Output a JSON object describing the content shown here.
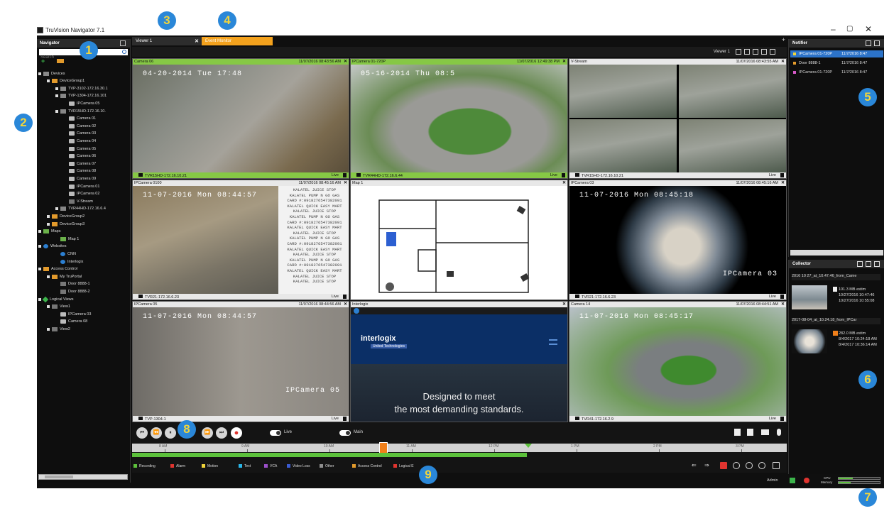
{
  "app": {
    "title": "TruVision Navigator 7.1"
  },
  "window": {
    "minimize": "–",
    "maximize": "▢",
    "close": "✕"
  },
  "navigator": {
    "title": "Navigator",
    "search_placeholder": "Search",
    "tree": [
      {
        "label": "Devices",
        "icon": "server",
        "level": 0
      },
      {
        "label": "DeviceGroup1",
        "icon": "folder",
        "level": 1
      },
      {
        "label": "TVP-3102-172.16.30.1",
        "icon": "server",
        "level": 2
      },
      {
        "label": "TVP-1304-172.16.101",
        "icon": "server",
        "level": 2
      },
      {
        "label": "IPCamera 05",
        "icon": "cam",
        "level": 3
      },
      {
        "label": "TVR15HD-172.16.10.",
        "icon": "server",
        "level": 2
      },
      {
        "label": "Camera 01",
        "icon": "cam",
        "level": 3
      },
      {
        "label": "Camera 02",
        "icon": "cam",
        "level": 3
      },
      {
        "label": "Camera 03",
        "icon": "cam",
        "level": 3
      },
      {
        "label": "Camera 04",
        "icon": "cam",
        "level": 3
      },
      {
        "label": "Camera 05",
        "icon": "cam",
        "level": 3
      },
      {
        "label": "Camera 06",
        "icon": "cam",
        "level": 3
      },
      {
        "label": "Camera 07",
        "icon": "cam",
        "level": 3
      },
      {
        "label": "Camera 08",
        "icon": "cam",
        "level": 3
      },
      {
        "label": "Camera 09",
        "icon": "cam",
        "level": 3
      },
      {
        "label": "IPCamera 01",
        "icon": "cam",
        "level": 3
      },
      {
        "label": "IPCamera 02",
        "icon": "cam",
        "level": 3
      },
      {
        "label": "V-Stream",
        "icon": "view",
        "level": 3
      },
      {
        "label": "TVR44HD-172.16.6.4",
        "icon": "server",
        "level": 2
      },
      {
        "label": "DeviceGroup2",
        "icon": "folder",
        "level": 1
      },
      {
        "label": "DeviceGroup3",
        "icon": "folder",
        "level": 1
      },
      {
        "label": "Maps",
        "icon": "map",
        "level": 0
      },
      {
        "label": "Map 1",
        "icon": "map",
        "level": 2
      },
      {
        "label": "Websites",
        "icon": "web",
        "level": 0
      },
      {
        "label": "CNN",
        "icon": "web",
        "level": 2
      },
      {
        "label": "Interlogix",
        "icon": "web",
        "level": 2
      },
      {
        "label": "Access Control",
        "icon": "ac",
        "level": 0
      },
      {
        "label": "My TruPortal",
        "icon": "ac",
        "level": 1
      },
      {
        "label": "Door 8888-1",
        "icon": "view",
        "level": 2
      },
      {
        "label": "Door 8888-2",
        "icon": "view",
        "level": 2
      },
      {
        "label": "Logical Views",
        "icon": "lv",
        "level": 0
      },
      {
        "label": "View1",
        "icon": "view",
        "level": 1
      },
      {
        "label": "IPCamera 03",
        "icon": "cam",
        "level": 2
      },
      {
        "label": "Camera 08",
        "icon": "cam",
        "level": 2
      },
      {
        "label": "View2",
        "icon": "view",
        "level": 1
      }
    ]
  },
  "tabs": [
    {
      "label": "Viewer 1",
      "close": "✕"
    },
    {
      "label": "Event Monitor",
      "close": "✕"
    }
  ],
  "tab_add": "+",
  "viewer_label": "Viewer 1",
  "cells": [
    {
      "name": "Camera 06",
      "time": "11/07/2016 08:43:56 AM",
      "footer": "TVR15HD-172.16.10.21",
      "live": "Live",
      "osd": "04-20-2014 Tue 17:48",
      "selected": true
    },
    {
      "name": "IPCamera 01-720P",
      "time": "11/07/2016 12:49:38 PM",
      "footer": "TVR44HD-172.16.6.44",
      "live": "Live",
      "osd": "05-16-2014 Thu 08:5",
      "selected": true
    },
    {
      "name": "V-Stream",
      "time": "11/07/2016 08:43:55 AM",
      "footer": "TVR15HD-172.16.10.21",
      "live": "Live",
      "osd": ""
    },
    {
      "name": "IPCamera 0100",
      "time": "11/07/2016 08:45:16 AM",
      "footer": "TVR21-172.16.6.23",
      "live": "Live",
      "osd": "11-07-2016 Mon 08:44:57"
    },
    {
      "name": "Map 1",
      "time": "",
      "footer": "",
      "live": "",
      "osd": ""
    },
    {
      "name": "IPCamera 03",
      "time": "11/07/2016 08:45:16 AM",
      "footer": "TVR21-172.16.6.23",
      "live": "Live",
      "osd": "11-07-2016 Mon 08:45:18"
    },
    {
      "name": "IPCamera 05",
      "time": "11/07/2016 08:44:56 AM",
      "footer": "TVP-1304-1",
      "live": "Live",
      "osd": "11-07-2016 Mon 08:44:57"
    },
    {
      "name": "Interlogix",
      "time": "",
      "footer": "",
      "live": "",
      "osd": ""
    },
    {
      "name": "Camera 14",
      "time": "11/07/2016 08:44:51 AM",
      "footer": "TVR41-172.16.2.9",
      "live": "Live",
      "osd": "11-07-2016 Mon 08:45:17"
    }
  ],
  "osd_camera_labels": {
    "cell6": "IPCamera 03",
    "cell7": "IPCamera 05"
  },
  "pos_lines": [
    "KALATEL JUICE STOP",
    "KALATEL PUMP N GO GAS",
    "CARD #:0918276547382091",
    "KALATEL QUICK EASY MART",
    "KALATEL JUICE STOP",
    "KALATEL PUMP N GO GAS",
    "CARD #:0918276547382091",
    "KALATEL QUICK EASY MART",
    "KALATEL JUICE STOP",
    "KALATEL PUMP N GO GAS",
    "CARD #:0918276547382091",
    "KALATEL QUICK EASY MART",
    "KALATEL JUICE STOP",
    "KALATEL PUMP N GO GAS",
    "CARD #:0918276547382091",
    "KALATEL QUICK EASY MART",
    "KALATEL JUICE STOP",
    "KALATEL JUICE STOP"
  ],
  "web": {
    "brand": "interlogix",
    "sub": "United Technologies",
    "tagline1": "Designed to meet",
    "tagline2": "the most demanding standards."
  },
  "playback": {
    "buttons": [
      "⏮",
      "⏪",
      "⏸",
      "⏩",
      "⏭",
      "●"
    ],
    "live_toggle": "Live",
    "main_toggle": "Main",
    "ticks": [
      "8 AM",
      "9 AM",
      "10 AM",
      "11 AM",
      "12 PM",
      "1 PM",
      "2 PM",
      "3 PM"
    ],
    "legend": [
      {
        "label": "Recording",
        "color": "#5cc13b"
      },
      {
        "label": "Alarm",
        "color": "#e0342f"
      },
      {
        "label": "Motion",
        "color": "#f0d43a"
      },
      {
        "label": "Text",
        "color": "#29b6e8"
      },
      {
        "label": "VCA",
        "color": "#9b4fc9"
      },
      {
        "label": "Video Loss",
        "color": "#3b5bd1"
      },
      {
        "label": "Other",
        "color": "#8e8e8e"
      },
      {
        "label": "Access Control",
        "color": "#e29a2c"
      },
      {
        "label": "Logical E",
        "color": "#e0342f"
      }
    ]
  },
  "notifier": {
    "title": "Notifier",
    "rows": [
      {
        "source": "IPCamera 01-720P",
        "time": "11/7/2016 8:47",
        "color": "#f0d43a",
        "selected": true
      },
      {
        "source": "Door 8888-1",
        "time": "11/7/2016 8:47",
        "color": "#e29a2c",
        "selected": false
      },
      {
        "source": "IPCamera 01-720P",
        "time": "11/7/2016 8:47",
        "color": "#d659c8",
        "selected": false
      }
    ]
  },
  "collector": {
    "title": "Collector",
    "items": [
      {
        "title": "2016 10 27_at_10.47.46_from_Came",
        "size": "101.3 MB estim",
        "start": "10/27/2016 10:47:46",
        "end": "10/27/2016 10:55:08"
      },
      {
        "title": "2017-08-04_at_10.24.18_from_IPCar",
        "size": "282.0 MB estim",
        "start": "8/4/2017 10:24:18 AM",
        "end": "8/4/2017 10:36:14 AM"
      }
    ]
  },
  "status": {
    "user": "Admin",
    "cpu": "CPU",
    "memory": "Memory",
    "cpu_level": 0.35,
    "memory_level": 0.3
  },
  "callouts": [
    "1",
    "2",
    "3",
    "4",
    "5",
    "6",
    "7",
    "8",
    "9"
  ]
}
